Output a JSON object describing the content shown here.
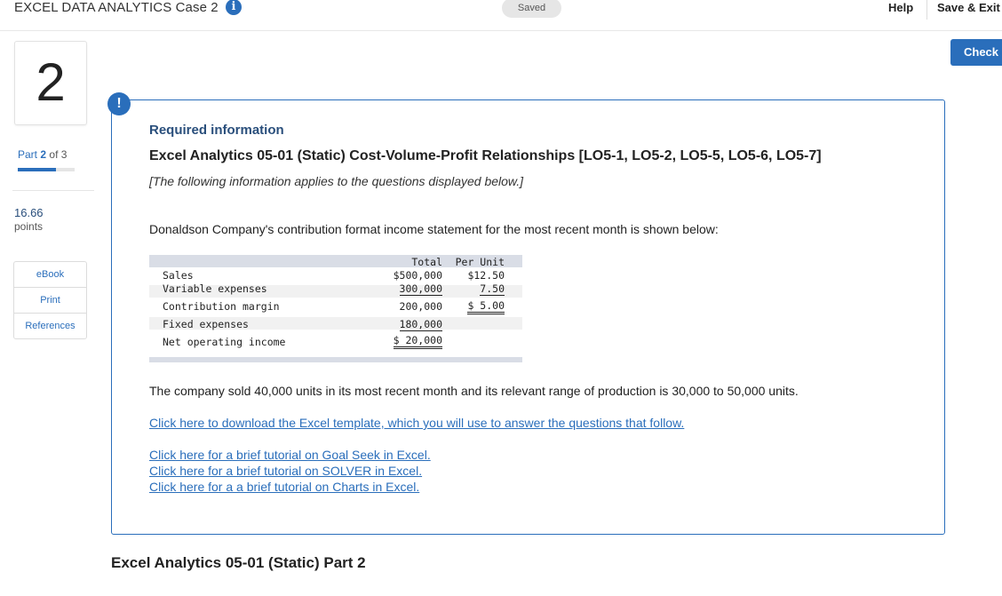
{
  "header": {
    "title": "EXCEL DATA ANALYTICS Case 2",
    "info_icon": "i",
    "saved": "Saved",
    "help": "Help",
    "save_exit": "Save & Exit",
    "check": "Check"
  },
  "sidebar": {
    "question_number": "2",
    "part_prefix": "Part",
    "part_current": "2",
    "part_of": "of 3",
    "part_progress_fraction": 0.67,
    "points_value": "16.66",
    "points_label": "points",
    "resources": [
      "eBook",
      "Print",
      "References"
    ]
  },
  "card": {
    "alert_icon": "!",
    "required_info": "Required information",
    "case_title": "Excel Analytics 05-01 (Static) Cost-Volume-Profit Relationships [LO5-1, LO5-2, LO5-5, LO5-6, LO5-7]",
    "applies_note": "[The following information applies to the questions displayed below.]",
    "intro": "Donaldson Company's contribution format income statement for the most recent month is shown below:",
    "statement": {
      "col_total": "Total",
      "col_unit": "Per Unit",
      "rows": [
        {
          "label": "Sales",
          "total": "$500,000",
          "unit": "$12.50"
        },
        {
          "label": "Variable expenses",
          "total": "300,000",
          "unit": "7.50"
        },
        {
          "label": "Contribution margin",
          "total": "200,000",
          "unit": "$ 5.00"
        },
        {
          "label": "Fixed expenses",
          "total": "180,000",
          "unit": ""
        },
        {
          "label": "Net operating income",
          "total": "$ 20,000",
          "unit": ""
        }
      ]
    },
    "sold_text": "The company sold 40,000 units in its most recent month and its relevant range of production is 30,000 to 50,000 units.",
    "links": [
      "Click here to download the Excel template, which you will use to answer the questions that follow.",
      "Click here for a brief tutorial on Goal Seek in Excel.",
      "Click here for a brief tutorial on SOLVER in Excel.",
      "Click here for a a brief tutorial on Charts in Excel."
    ]
  },
  "part_heading": "Excel Analytics 05-01 (Static) Part 2",
  "colors": {
    "accent": "#2a6ebb",
    "title_blue": "#2a4f7c",
    "table_header": "#d9dde6"
  }
}
